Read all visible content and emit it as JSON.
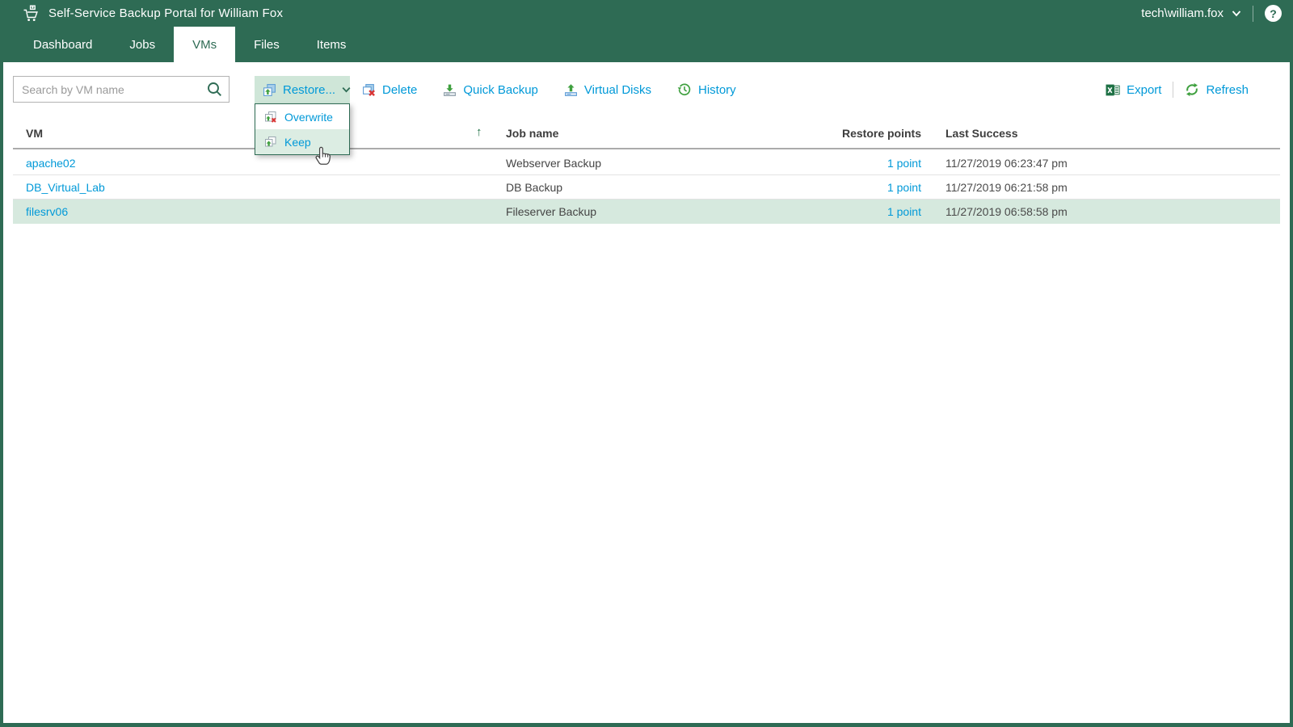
{
  "topbar": {
    "title": "Self-Service Backup Portal for William Fox",
    "user": "tech\\william.fox",
    "help_label": "?"
  },
  "nav": {
    "tabs": [
      {
        "label": "Dashboard",
        "active": false
      },
      {
        "label": "Jobs",
        "active": false
      },
      {
        "label": "VMs",
        "active": true
      },
      {
        "label": "Files",
        "active": false
      },
      {
        "label": "Items",
        "active": false
      }
    ]
  },
  "toolbar": {
    "search_placeholder": "Search by VM name",
    "restore_label": "Restore...",
    "delete_label": "Delete",
    "quick_backup_label": "Quick Backup",
    "virtual_disks_label": "Virtual Disks",
    "history_label": "History",
    "export_label": "Export",
    "refresh_label": "Refresh"
  },
  "restore_menu": {
    "items": [
      {
        "label": "Overwrite",
        "hovered": false
      },
      {
        "label": "Keep",
        "hovered": true
      }
    ]
  },
  "table": {
    "columns": {
      "vm": "VM",
      "job": "Job name",
      "points": "Restore points",
      "last": "Last Success"
    },
    "sort": {
      "column": "vm",
      "direction": "ascending",
      "glyph": "↑"
    },
    "rows": [
      {
        "vm": "apache02",
        "job": "Webserver Backup",
        "points": "1 point",
        "last": "11/27/2019 06:23:47 pm",
        "selected": false
      },
      {
        "vm": "DB_Virtual_Lab",
        "job": "DB Backup",
        "points": "1 point",
        "last": "11/27/2019 06:21:58 pm",
        "selected": false
      },
      {
        "vm": "filesrv06",
        "job": "Fileserver Backup",
        "points": "1 point",
        "last": "11/27/2019 06:58:58 pm",
        "selected": true
      }
    ]
  },
  "colors": {
    "header_green": "#2e6b54",
    "accent_blue": "#0099d8",
    "action_green": "#3fa03f",
    "selected_row_bg": "#d6e9de",
    "restore_button_bg": "#cfe6d8",
    "menu_hover_bg": "#dcede3",
    "danger_red": "#d93636"
  }
}
